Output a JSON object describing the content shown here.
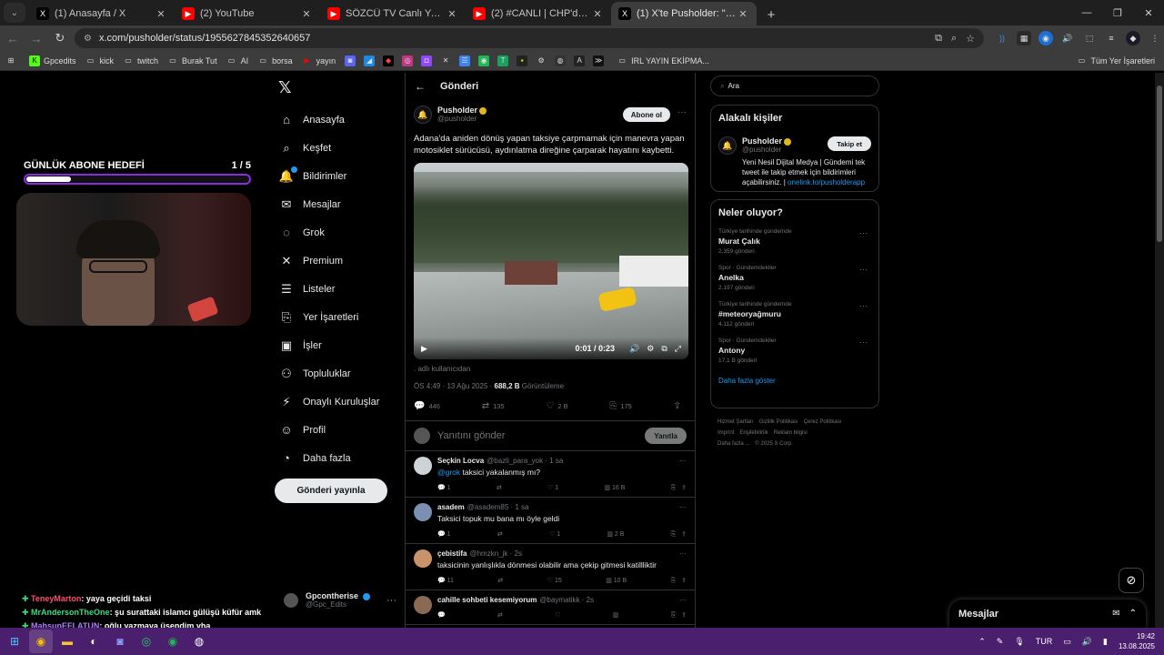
{
  "browser": {
    "tabs": [
      {
        "title": "(1) Anasayfa / X",
        "fav": "X",
        "favcolor": "#000000",
        "active": false
      },
      {
        "title": "(2) YouTube",
        "fav": "▶",
        "favcolor": "#ff0000",
        "active": false
      },
      {
        "title": "SÖZCÜ TV Canlı Yayını ᴴᴰ - You",
        "fav": "▶",
        "favcolor": "#ff0000",
        "active": false
      },
      {
        "title": "(2) #CANLI | CHP'den Bayramp",
        "fav": "▶",
        "favcolor": "#ff0000",
        "active": false
      },
      {
        "title": "(1) X'te Pusholder: \"Adana'da a",
        "fav": "X",
        "favcolor": "#000000",
        "active": true
      }
    ],
    "url": "x.com/pusholder/status/1955627845352640657",
    "bookmarks": [
      "Gpcedits",
      "kick",
      "twitch",
      "Burak Tut",
      "AI",
      "borsa",
      "yayın",
      "IRL YAYIN EKİPMA..."
    ],
    "bookmarks_right": "Tüm Yer İşaretleri"
  },
  "overlay": {
    "goal_title": "GÜNLÜK ABONE HEDEFİ",
    "goal_count": "1 / 5",
    "goal_progress": 0.2,
    "chat": [
      {
        "user": "TeneyMarton",
        "color": "#ff4d6d",
        "text": ": yaya geçidi taksi"
      },
      {
        "user": "MrAndersonTheOne",
        "color": "#3ddc84",
        "text": ": şu surattaki islamcı gülüşü küfür amk"
      },
      {
        "user": "MahsunEFLATUN",
        "color": "#b07cff",
        "text": ": oğlu yazmaya üşendim yha"
      }
    ]
  },
  "nav": {
    "items": [
      {
        "label": "Anasayfa",
        "icon": "home-icon",
        "glyph": "⌂"
      },
      {
        "label": "Keşfet",
        "icon": "search-icon",
        "glyph": "⌕"
      },
      {
        "label": "Bildirimler",
        "icon": "bell-icon",
        "glyph": "🔔"
      },
      {
        "label": "Mesajlar",
        "icon": "mail-icon",
        "glyph": "✉"
      },
      {
        "label": "Grok",
        "icon": "grok-icon",
        "glyph": "◌"
      },
      {
        "label": "Premium",
        "icon": "x-premium-icon",
        "glyph": "✕"
      },
      {
        "label": "Listeler",
        "icon": "list-icon",
        "glyph": "☰"
      },
      {
        "label": "Yer İşaretleri",
        "icon": "bookmark-icon",
        "glyph": "⎘"
      },
      {
        "label": "İşler",
        "icon": "briefcase-icon",
        "glyph": "▣"
      },
      {
        "label": "Topluluklar",
        "icon": "communities-icon",
        "glyph": "⚇"
      },
      {
        "label": "Onaylı Kuruluşlar",
        "icon": "verified-org-icon",
        "glyph": "⚡"
      },
      {
        "label": "Profil",
        "icon": "profile-icon",
        "glyph": "☺"
      },
      {
        "label": "Daha fazla",
        "icon": "more-icon",
        "glyph": "◔"
      }
    ],
    "post_button": "Gönderi yayınla",
    "account_name": "Gpcontherise",
    "account_handle": "@Gpc_Edits"
  },
  "main": {
    "header": "Gönderi",
    "post": {
      "name": "Pusholder",
      "handle": "@pusholder",
      "follow": "Abone ol",
      "text": "Adana'da aniden dönüş yapan taksiye çarpmamak için manevra yapan motosiklet sürücüsü, aydınlatma direğine çarparak hayatını kaybetti.",
      "video_time": "0:01 / 0:23",
      "tagged": ". adlı kullanıcıdan",
      "timestamp": "ÖS 4:49 · 13 Ağu 2025 · ",
      "views": "688,2 B",
      "views_label": " Görüntüleme",
      "replies": "446",
      "reposts": "135",
      "likes": "2 B",
      "bookmarks": "175"
    },
    "reply_placeholder": "Yanıtını gönder",
    "reply_button": "Yanıtla",
    "replies": [
      {
        "name": "Seçkin Locva",
        "handle": "@bazli_para_yok · 1 sa",
        "mention": "@grok",
        "text": " taksici yakalanmış mı?",
        "r": "1",
        "rt": "",
        "l": "1",
        "v": "16 B",
        "avcolor": "#cfd3d6"
      },
      {
        "name": "asadem",
        "handle": "@asadem85 · 1 sa",
        "mention": "",
        "text": "Taksici topuk mu bana mı öyle geldi",
        "r": "1",
        "rt": "",
        "l": "1",
        "v": "2 B",
        "avcolor": "#7b8fb0"
      },
      {
        "name": "çebistifa",
        "handle": "@hmzkn_jk · 2s",
        "mention": "",
        "text": "taksicinin yanlışlıkla dönmesi olabilir ama çekip gitmesi katillliktir",
        "r": "11",
        "rt": "",
        "l": "15",
        "v": "10 B",
        "avcolor": "#c9936a"
      },
      {
        "name": "cahille sohbeti kesemiyorum",
        "handle": "@baymatikk · 2s",
        "mention": "",
        "text": "",
        "r": "",
        "rt": "",
        "l": "",
        "v": "",
        "avcolor": "#8a6a55"
      }
    ]
  },
  "sidebar": {
    "search_placeholder": "Ara",
    "related_title": "Alakalı kişiler",
    "related": {
      "name": "Pusholder",
      "handle": "@pusholder",
      "follow": "Takip et",
      "bio": "Yeni Nesil Dijital Medya | Gündemi tek tweet ile takip etmek için bildirimleri açabilirsiniz. | ",
      "link": "onelink.to/pusholderapp"
    },
    "trends_title": "Neler oluyor?",
    "trends": [
      {
        "context": "Türkiye tarihinde gündemde",
        "name": "Murat Çalık",
        "posts": "2.359 gönderi"
      },
      {
        "context": "Spor · Gündemdekiler",
        "name": "Anelka",
        "posts": "2.197 gönderi"
      },
      {
        "context": "Türkiye tarihinde gündemde",
        "name": "#meteoryağmuru",
        "posts": "4.112 gönderi"
      },
      {
        "context": "Spor · Gündemdekiler",
        "name": "Antony",
        "posts": "17,1 B gönderi"
      }
    ],
    "show_more": "Daha fazla göster",
    "footer": [
      "Hizmet Şartları",
      "Gizlilik Politikası",
      "Çerez Politikası",
      "Imprint",
      "Erişilebilirlik",
      "Reklam bilgisi",
      "Daha fazla ...",
      "© 2025 X Corp."
    ]
  },
  "drawer": {
    "title": "Mesajlar"
  },
  "taskbar": {
    "lang": "TUR",
    "time": "19:42",
    "date": "13.08.2025"
  }
}
